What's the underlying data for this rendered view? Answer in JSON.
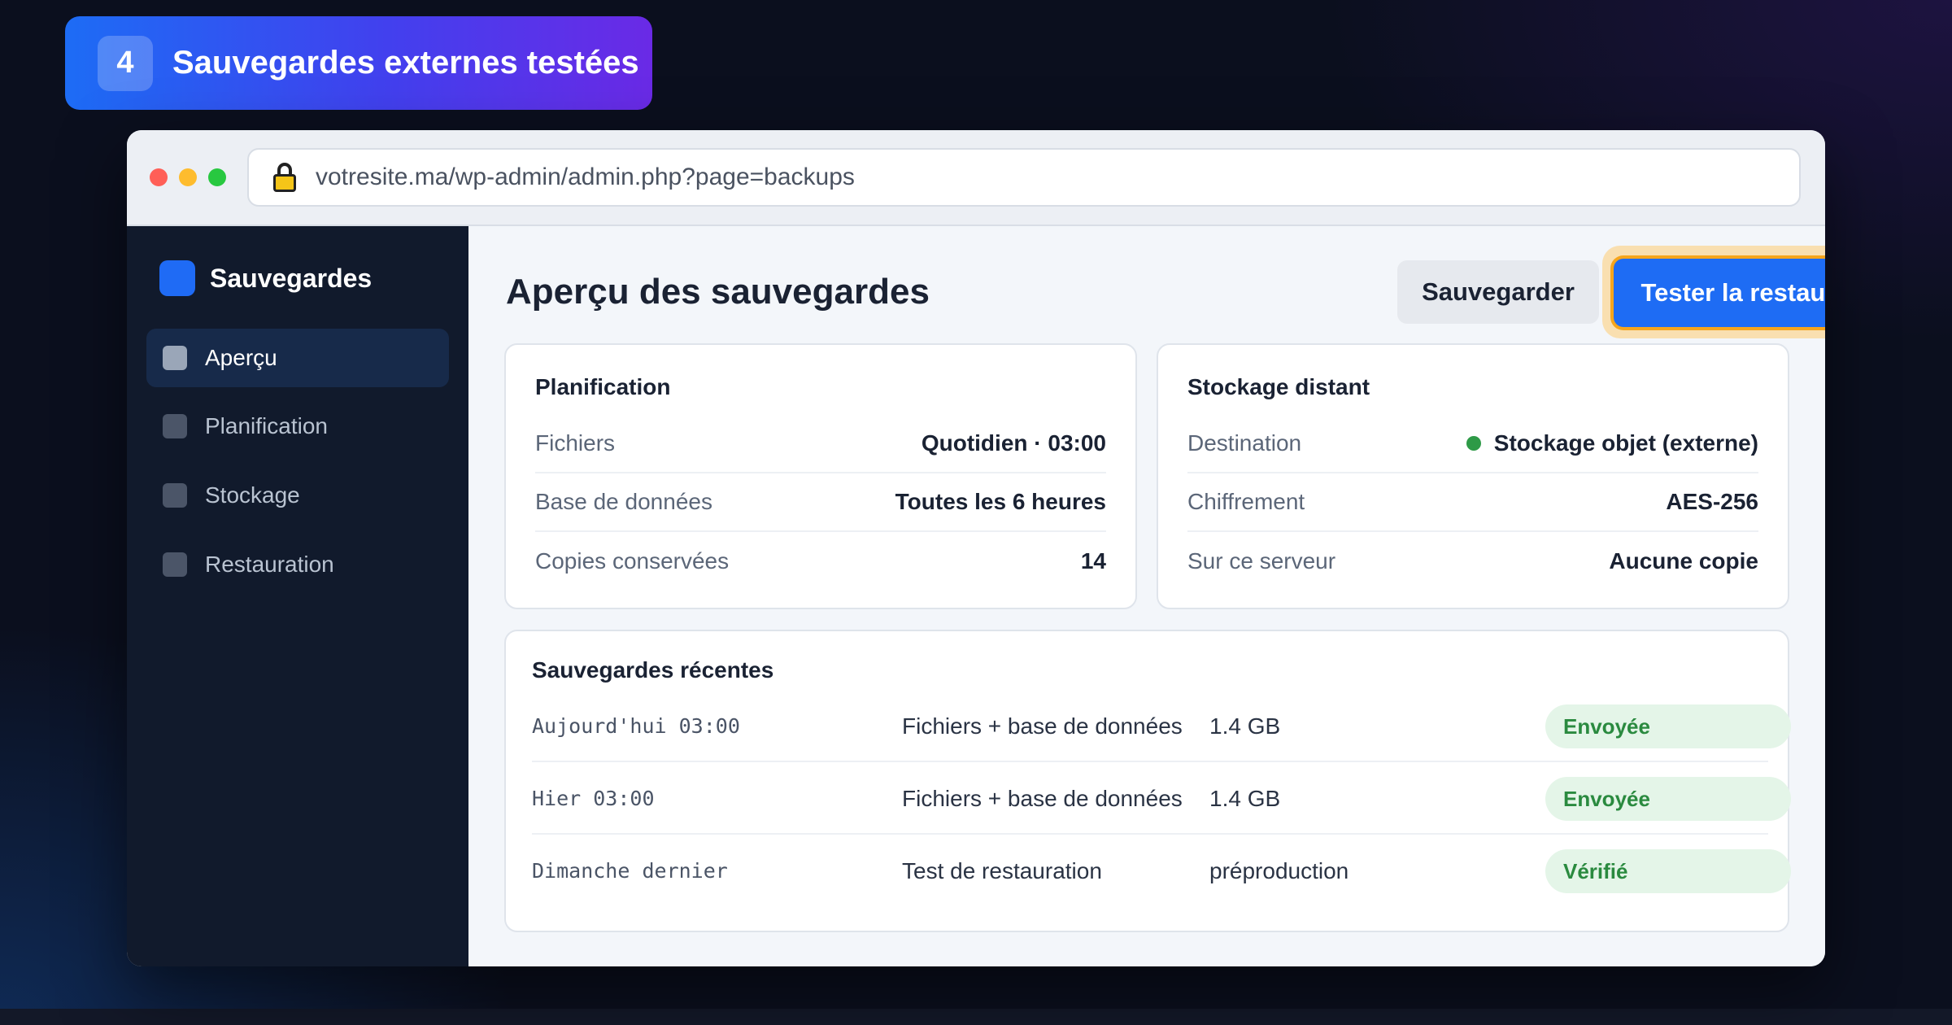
{
  "step": {
    "number": "4",
    "title": "Sauvegardes externes testées"
  },
  "browser": {
    "url": "votresite.ma/wp-admin/admin.php?page=backups"
  },
  "sidebar": {
    "brand": "Sauvegardes",
    "items": [
      {
        "label": "Aperçu",
        "active": true
      },
      {
        "label": "Planification",
        "active": false
      },
      {
        "label": "Stockage",
        "active": false
      },
      {
        "label": "Restauration",
        "active": false
      }
    ]
  },
  "header": {
    "title": "Aperçu des sauvegardes",
    "secondary_button": "Sauvegarder",
    "primary_button": "Tester la restauration"
  },
  "schedule": {
    "title": "Planification",
    "rows": [
      {
        "key": "Fichiers",
        "value": "Quotidien · 03:00"
      },
      {
        "key": "Base de données",
        "value": "Toutes les 6 heures"
      },
      {
        "key": "Copies conservées",
        "value": "14"
      }
    ]
  },
  "storage": {
    "title": "Stockage distant",
    "rows": [
      {
        "key": "Destination",
        "value": "Stockage objet (externe)"
      },
      {
        "key": "Chiffrement",
        "value": "AES-256"
      },
      {
        "key": "Sur ce serveur",
        "value": "Aucune copie"
      }
    ],
    "status_color": "#2e9a47"
  },
  "recent": {
    "title": "Sauvegardes récentes",
    "rows": [
      {
        "time": "Aujourd'hui 03:00",
        "type": "Fichiers + base de données",
        "size": "1.4 GB",
        "status": "Envoyée"
      },
      {
        "time": "Hier 03:00",
        "type": "Fichiers + base de données",
        "size": "1.4 GB",
        "status": "Envoyée"
      },
      {
        "time": "Dimanche dernier",
        "type": "Test de restauration",
        "size": "préproduction",
        "status": "Vérifié"
      }
    ]
  },
  "colors": {
    "accent": "#1e6cf4",
    "highlight": "#f6a51c",
    "success": "#2a8a3f"
  }
}
